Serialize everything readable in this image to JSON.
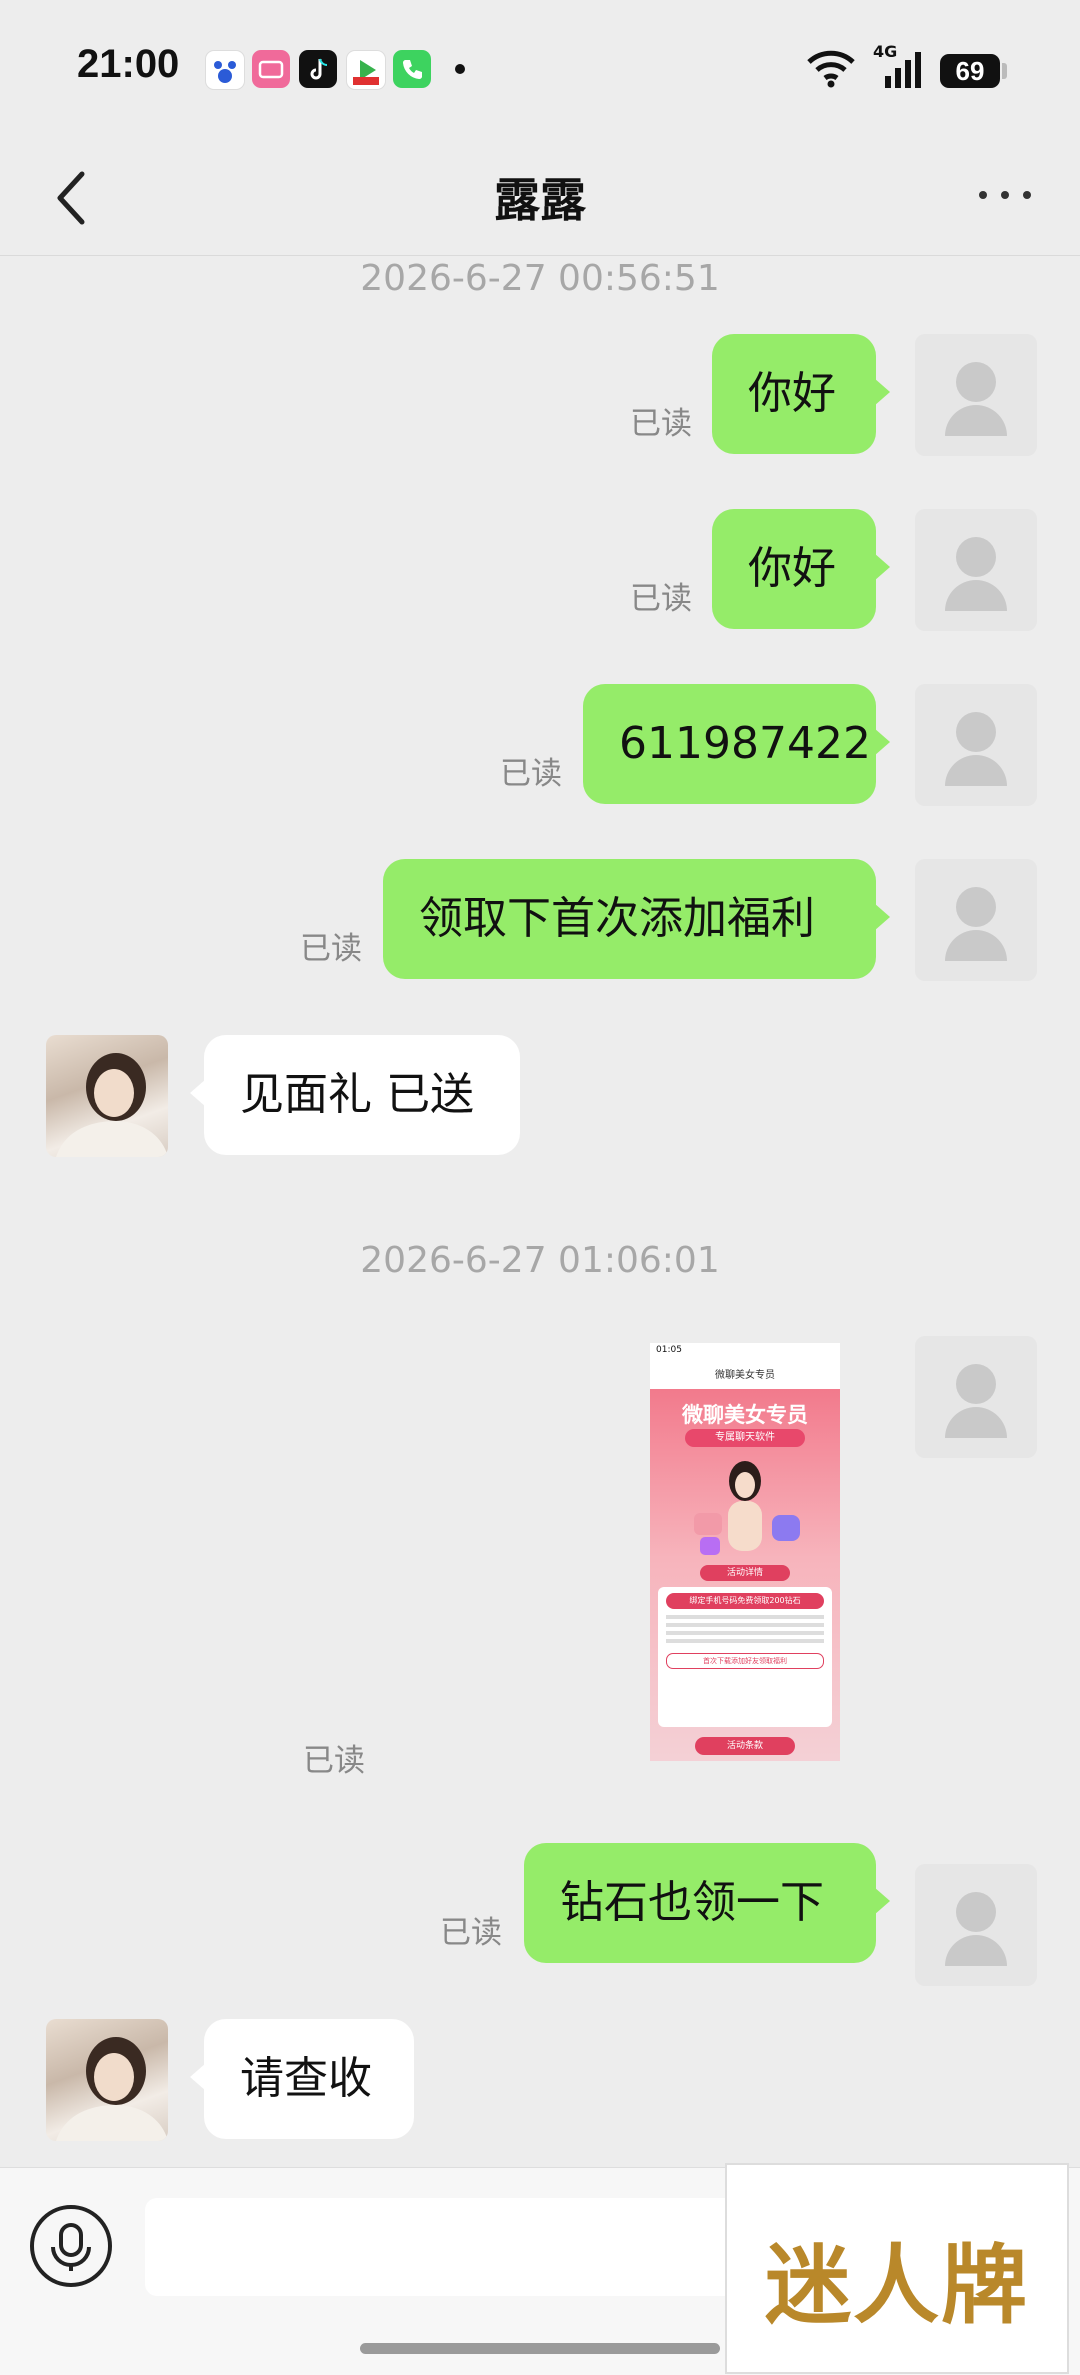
{
  "status_bar": {
    "time": "21:00",
    "network": "4G",
    "battery": "69"
  },
  "header": {
    "title": "露露"
  },
  "messages": {
    "ts1": "2026-6-27 00:56:51",
    "m1": "你好",
    "m2": "你好",
    "m3": "611987422",
    "m4": "领取下首次添加福利",
    "m5": "见面礼 已送",
    "ts2": "2026-6-27 01:06:01",
    "m7": "钻石也领一下",
    "m8": "请查收",
    "read": "已读"
  },
  "shared_screenshot": {
    "time": "01:05",
    "page_title": "微聊美女专员",
    "banner": "微聊美女专员",
    "subtitle": "专属聊天软件",
    "section": "活动详情",
    "cta": "绑定手机号码免费领取200钻石",
    "notice": "首次下载添加好友领取福利",
    "footer": "活动条款"
  },
  "watermark": {
    "text": "迷人牌"
  },
  "colors": {
    "outgoing_bubble": "#95ec69",
    "incoming_bubble": "#ffffff",
    "background": "#ededed"
  }
}
